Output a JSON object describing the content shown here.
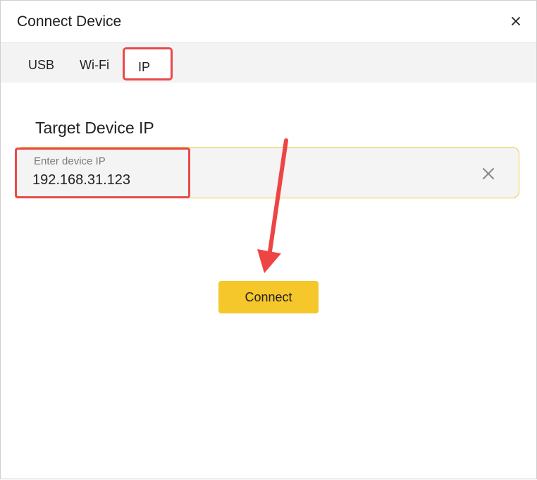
{
  "dialog": {
    "title": "Connect Device",
    "close_icon": "close-icon"
  },
  "tabs": [
    {
      "label": "USB",
      "selected": false
    },
    {
      "label": "Wi-Fi",
      "selected": false
    },
    {
      "label": "IP",
      "selected": true
    }
  ],
  "form": {
    "section_label": "Target Device IP",
    "ip_placeholder": "Enter device IP",
    "ip_value": "192.168.31.123",
    "clear_icon": "clear-x-icon"
  },
  "actions": {
    "connect_label": "Connect"
  },
  "annotations": {
    "highlight_color": "#e84a4a",
    "arrow_color": "#ee4444"
  },
  "colors": {
    "accent_yellow": "#f5c72b",
    "field_border": "#f0cb45",
    "tabbar_bg": "#f3f3f3"
  }
}
